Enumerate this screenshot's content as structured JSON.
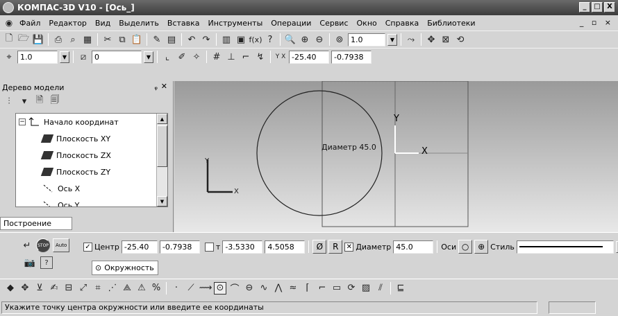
{
  "window": {
    "title": "КОМПАС-3D V10 - [Ось_]",
    "min": "_",
    "max": "□",
    "close": "X"
  },
  "menu": {
    "items": [
      "Файл",
      "Редактор",
      "Вид",
      "Выделить",
      "Вставка",
      "Инструменты",
      "Операции",
      "Сервис",
      "Окно",
      "Справка",
      "Библиотеки"
    ],
    "mdi_controls": "_ ▫ ×"
  },
  "toolbar_standard": {
    "zoom_value": "1.0"
  },
  "toolbar_current": {
    "step_value": "1.0",
    "layer_value": "0",
    "coord_x": "-25.40",
    "coord_y": "-0.7938"
  },
  "tree_panel": {
    "title": "Дерево модели",
    "pin": "ᵩ",
    "close": "✕",
    "items": [
      {
        "label": "Начало координат",
        "icon": "origin-icon"
      },
      {
        "label": "Плоскость XY",
        "icon": "plane-icon"
      },
      {
        "label": "Плоскость ZX",
        "icon": "plane-icon"
      },
      {
        "label": "Плоскость ZY",
        "icon": "plane-icon"
      },
      {
        "label": "Ось X",
        "icon": "axis-icon"
      },
      {
        "label": "Ось Y",
        "icon": "axis-icon"
      }
    ],
    "tab_label": "Построение"
  },
  "canvas": {
    "triad_y": "Y",
    "triad_x": "X",
    "cs_y": "Y",
    "cs_x": "X",
    "diameter_label": "Диаметр 45.0"
  },
  "properties": {
    "center_label": "Центр",
    "center_x": "-25.40",
    "center_y": "-0.7938",
    "point_label": "т",
    "point_x": "-3.5330",
    "point_y": "4.5058",
    "diameter_symbol": "Ø",
    "radius_symbol": "R",
    "diameter_label": "Диаметр",
    "diameter_value": "45.0",
    "axes_label": "Оси",
    "style_label": "Стиль",
    "stop_label": "STOP",
    "auto_label": "Auto",
    "tab_label": "Окружность"
  },
  "status": {
    "message": "Укажите точку центра окружности или введите ее координаты"
  }
}
